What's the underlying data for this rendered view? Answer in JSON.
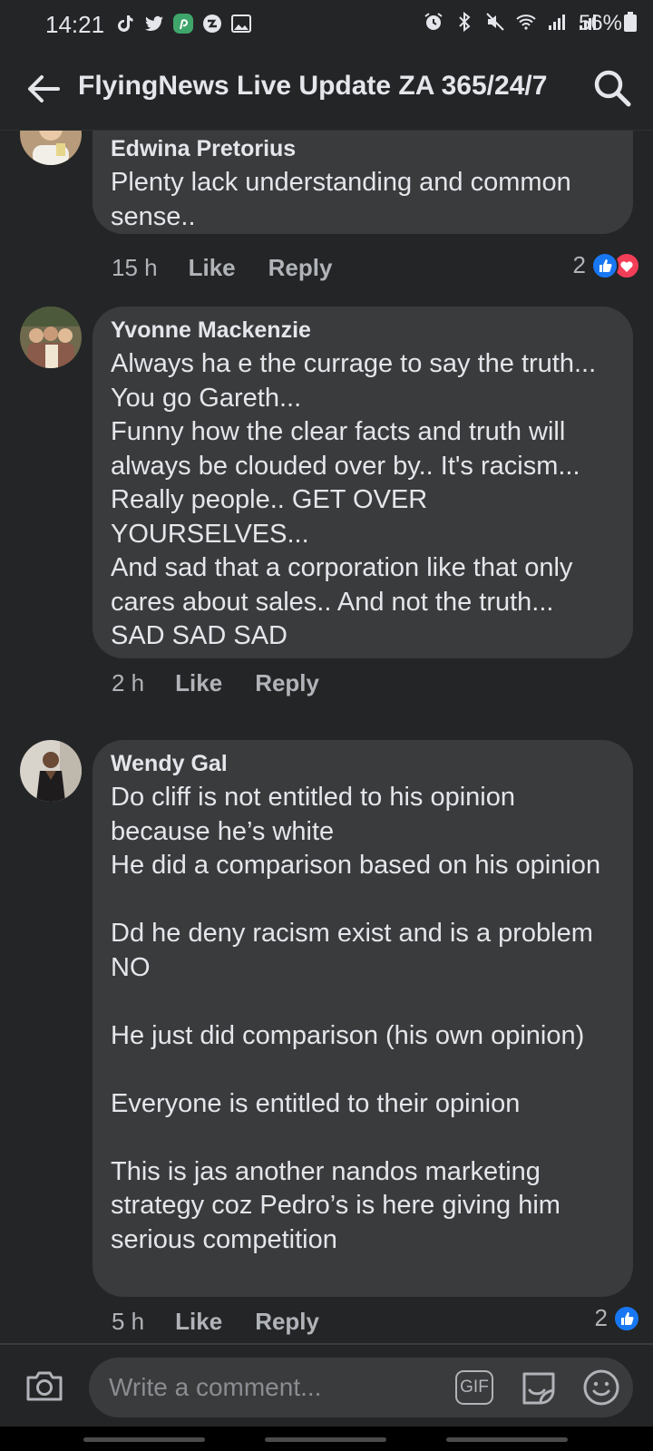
{
  "status_bar": {
    "time": "14:21",
    "battery": "56%",
    "left_icons": [
      "tiktok-icon",
      "twitter-icon",
      "pinterest-icon",
      "vpn-icon",
      "gallery-icon"
    ],
    "right_icons": [
      "alarm-icon",
      "bluetooth-icon",
      "mute-icon",
      "wifi-icon",
      "signal-icon",
      "signal-icon"
    ]
  },
  "header": {
    "title": "FlyingNews Live Update ZA 365/24/7"
  },
  "comments": [
    {
      "author": "Edwina Pretorius",
      "text": "Plenty lack understanding and common sense..",
      "time": "15 h",
      "like_label": "Like",
      "reply_label": "Reply",
      "reaction_count": "2",
      "reactions": [
        "like",
        "love"
      ]
    },
    {
      "author": "Yvonne Mackenzie",
      "text": "Always ha e the currage to say the truth... You go Gareth...\nFunny how the clear facts and truth will always be clouded over by.. It's racism...\nReally people.. GET OVER YOURSELVES...\nAnd sad that a corporation like that only cares about sales.. And not the truth...\nSAD SAD SAD",
      "time": "2 h",
      "like_label": "Like",
      "reply_label": "Reply"
    },
    {
      "author": "Wendy Gal",
      "text": "Do cliff is not entitled to his opinion because he’s white\nHe did a comparison based on his opinion\n\nDd he deny racism exist and is a problem NO\n\nHe just did comparison (his own opinion)\n\nEveryone is entitled to their opinion\n\nThis is jas another nandos marketing strategy coz Pedro’s is here giving him serious competition",
      "time": "5 h",
      "like_label": "Like",
      "reply_label": "Reply",
      "reaction_count": "2",
      "reactions": [
        "like"
      ]
    }
  ],
  "composer": {
    "placeholder": "Write a comment...",
    "gif_label": "GIF"
  },
  "colors": {
    "background": "#242526",
    "bubble": "#3a3b3c",
    "text": "#e4e6eb",
    "secondary_text": "#b0b3b8",
    "like_blue": "#1877f2",
    "love_red": "#f33e58"
  }
}
